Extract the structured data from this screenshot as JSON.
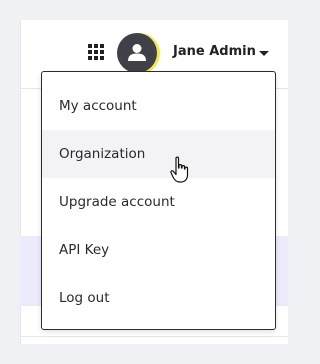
{
  "header": {
    "user_name": "Jane Admin",
    "apps_icon": "grid-icon",
    "avatar_icon": "user-icon",
    "avatar_ring_color": "#f5e64b"
  },
  "menu": {
    "items": [
      {
        "label": "My account"
      },
      {
        "label": "Organization",
        "hovered": true
      },
      {
        "label": "Upgrade account"
      },
      {
        "label": "API Key"
      },
      {
        "label": "Log out"
      }
    ]
  },
  "cursor": "hand-pointer-icon"
}
